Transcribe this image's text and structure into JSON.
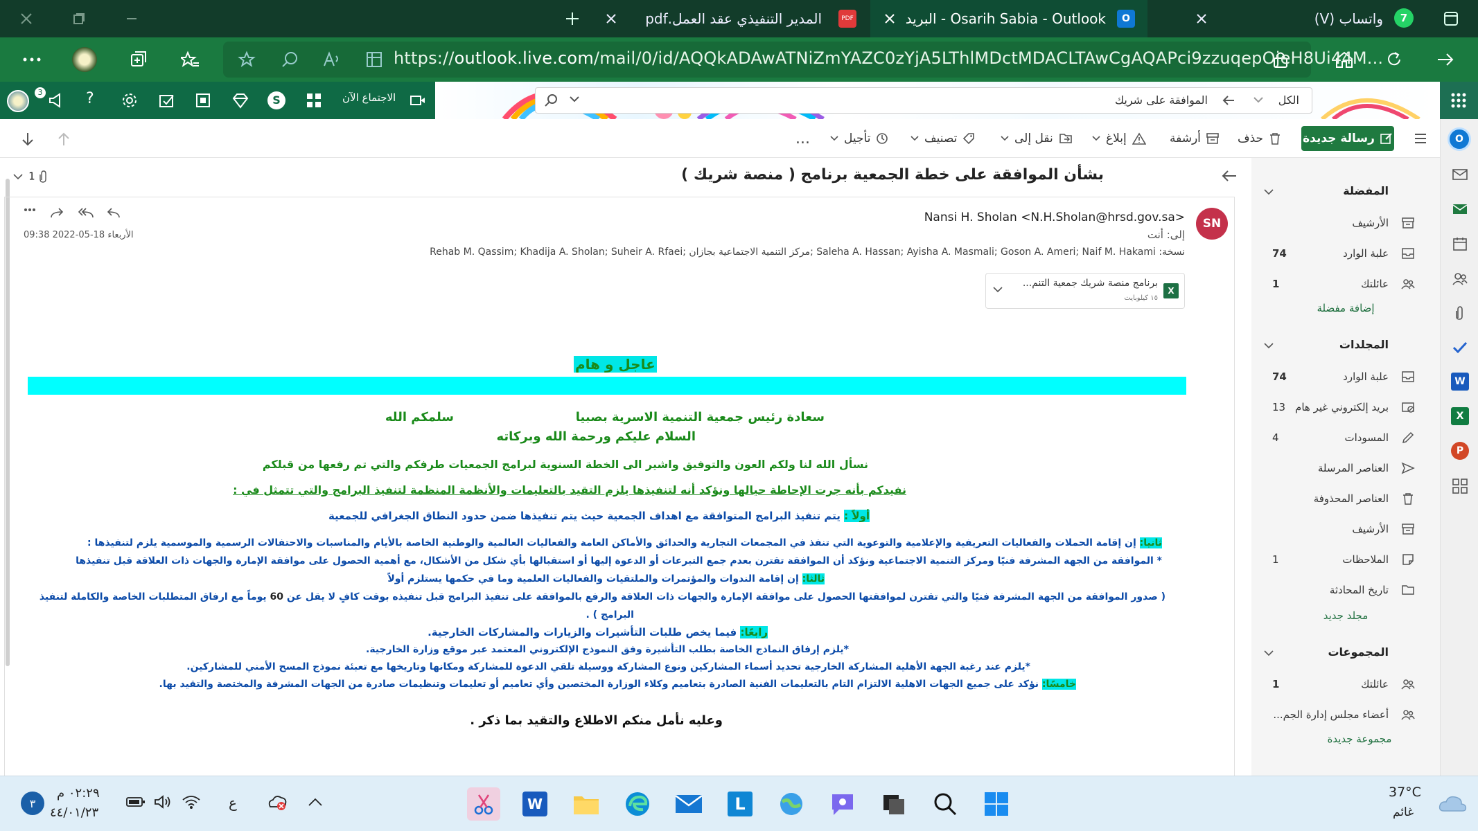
{
  "browser": {
    "tabs": [
      {
        "label": "Osarih Sabia - Outlook - البريد",
        "active": true
      },
      {
        "label": "المدير التنفيذي عقد العمل.pdf",
        "active": false
      },
      {
        "label": "واتساب (V)",
        "badge": "7",
        "active": false
      }
    ],
    "url_host": "outlook.live.com",
    "url_path": "/mail/0/id/AQQkADAwATNiZmYAZC0zYjA5LThlMDctMDACLTAwCgAQAPci9zzuqepOjeH8Ui44M..."
  },
  "outlook_header": {
    "meet_now": "الاجتماع الآن",
    "notif_count": "3",
    "search_value": "الموافقة على شريك",
    "search_scope": "الكل"
  },
  "toolbar": {
    "new_mail": "رسالة جديدة",
    "delete": "حذف",
    "archive": "أرشفة",
    "report": "إبلاغ",
    "move_to": "نقل إلى",
    "categorize": "تصنيف",
    "snooze": "تأجيل",
    "more": "..."
  },
  "message": {
    "subject": "بشأن الموافقة على خطة الجمعية برنامج ( منصة شريك )",
    "attachment_count": "1",
    "avatar_initials": "SN",
    "sender": "Nansi H. Sholan <N.H.Sholan@hrsd.gov.sa>",
    "to_label": "إلى:",
    "to_value": "أنت",
    "cc_label": "نسخة:",
    "cc_value": "Rehab M. Qassim; Khadija A. Sholan; Suheir A. Rfaei; مركز التنمية الاجتماعية بجازان; Saleha A. Hassan; Ayisha A. Masmali; Goson A. Ameri; Naif M. Hakami",
    "date": "الأربعاء 18-05-2022 09:38",
    "attachment_name": "برنامج منصة شريك جمعية التنم...",
    "attachment_size": "١٥ كيلوبايت",
    "body": {
      "urgent": "عاجل و هام",
      "salutation_to": "سعادة رئيس جمعية التنمية الاسرية بصبيا",
      "salutation_regards": "سلمكم الله",
      "greeting": "السلام عليكم ورحمة الله وبركاته",
      "intro": "نسأل الله لنا ولكم العون والتوفيق واشير الى الخطة السنوية لبرامج الجمعيات طرفكم والتي تم رفعها من قبلكم",
      "notice": "نفيدكم  بأنه جرت الإحاطة حيالها ونؤكد أنه لتنفيذها  يلزم التقيد بالتعليمات والأنظمة المنظمة لتنفيذ البرامج والتي تتمثل في :",
      "first_label": "أولاً :",
      "first_text": " يتم تنفيذ البرامج المتوافقة مع اهداف الجمعية حيث يتم تنفيذها ضمن حدود النطاق الجغرافي للجمعية",
      "second_label": "ثانيا:",
      "second_text": " إن إقامة الحملات والفعاليات التعريفية والإعلامية والتوعوية التي تنفذ في  المجمعات التجارية والحدائق  والأماكن العامة والفعاليات العالمية والوطنية الخاصة بالأيام والمناسبات والاحتفالات الرسمية والموسمية يلزم لتنفيذها :",
      "second_note": "*  الموافقة من الجهة المشرفة فنيًا ومركز التنمية الاجتماعية  ونؤكد  أن الموافقة تقترن بعدم  جمع التبرعات أو الدعوة إليها أو استقبالها بأي شكل من الأشكال، مع أهمية الحصول على موافقة الإمارة والجهات ذات العلاقة قبل تنفيذها",
      "third_label": "ثالثا:",
      "third_text": " إن إقامة الندوات والمؤتمرات والملتقيات والفعاليات العلمية وما في حكمها يستلزم أولاً",
      "third_note_a": "(  صدور الموافقة من الجهة المشرفة فنيًا والتي تقترن لموافقتها الحصول على موافقة الإمارة والجهات ذات العلاقة والرفع بالموافقة على تنفيذ البرامج قبل تنفيذه بوقت كافٍ لا يقل عن ",
      "third_days": "60",
      "third_note_b": " يوماً مع ارفاق المتطلبات الخاصة والكاملة لتنفيذ",
      "third_note_c": "البرامج ) .",
      "fourth_label": "رابعًا:",
      "fourth_text": " فيما يخص طلبات التأشيرات والزيارات والمشاركات الخارجية.",
      "fourth_note1": "*يلزم إرفاق النماذج الخاصة بطلب التأشيرة وفق النموذج الإلكتروني المعتمد عبر موقع وزارة الخارجية.",
      "fourth_note2": "*يلزم عند رغبة الجهة الأهلية المشاركة الخارجية تحديد أسماء المشاركين ونوع المشاركة ووسيلة تلقي الدعوة للمشاركة ومكانها وتاريخها مع تعبئة نموذج المسح الأمني للمشاركين.",
      "fifth_label": "خامسًا:",
      "fifth_text": " نؤكد على جميع الجهات الاهلية الالتزام التام بالتعليمات الفنية الصادرة بتعاميم وكلاء الوزارة المختصين وأي تعاميم أو تعليمات وتنظيمات صادرة من الجهات المشرفة والمختصة والتقيد بها.",
      "closing": "وعليه نأمل منكم الاطلاع والتقيد بما ذكر ."
    }
  },
  "folders": {
    "favorites_header": "المفضلة",
    "favorites": [
      {
        "name": "الأرشيف",
        "count": ""
      },
      {
        "name": "علبة الوارد",
        "count": "74"
      },
      {
        "name": "عائلتك",
        "count": "1"
      }
    ],
    "add_favorite": "إضافة مفضلة",
    "folders_header": "المجلدات",
    "folders": [
      {
        "name": "علبة الوارد",
        "count": "74"
      },
      {
        "name": "بريد إلكتروني غير هام",
        "count": "13"
      },
      {
        "name": "المسودات",
        "count": "4"
      },
      {
        "name": "العناصر المرسلة",
        "count": ""
      },
      {
        "name": "العناصر المحذوفة",
        "count": ""
      },
      {
        "name": "الأرشيف",
        "count": ""
      },
      {
        "name": "الملاحظات",
        "count": "1"
      },
      {
        "name": "تاريخ المحادثة",
        "count": ""
      }
    ],
    "new_folder": "مجلد جديد",
    "groups_header": "المجموعات",
    "groups": [
      {
        "name": "عائلتك",
        "count": "1"
      },
      {
        "name": "أعضاء مجلس إدارة الجم...",
        "count": ""
      }
    ],
    "new_group": "مجموعة جديدة"
  },
  "taskbar": {
    "time": "٠٢:٢٩ م",
    "date": "٤٤/٠١/٢٣",
    "notif": "٣",
    "lang": "ع",
    "temp": "37°C",
    "weather": "غائم"
  }
}
